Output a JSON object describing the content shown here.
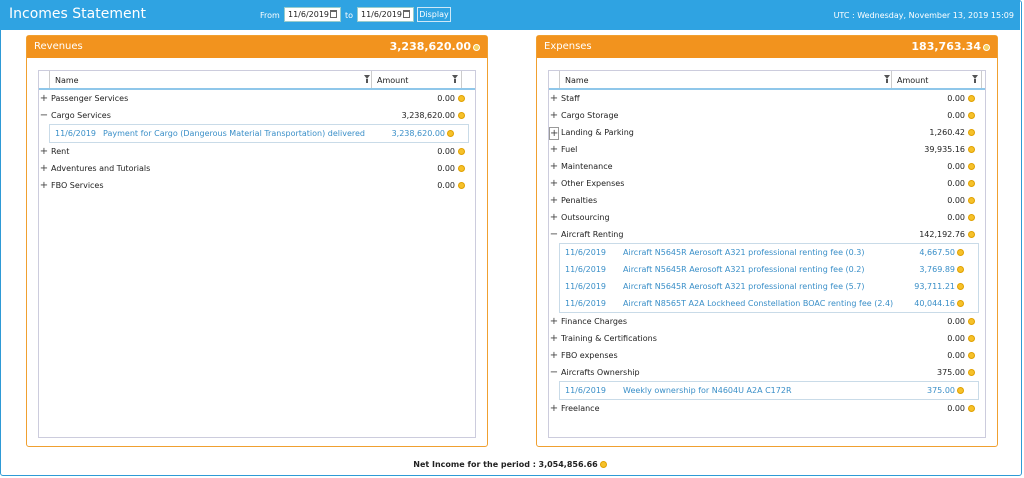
{
  "header": {
    "title": "Incomes Statement",
    "from_label": "From",
    "from_value": "11/6/2019",
    "to_label": "to",
    "to_value": "11/6/2019",
    "display_label": "Display",
    "clock": "UTC : Wednesday, November 13, 2019 15:09"
  },
  "revenues": {
    "title": "Revenues",
    "total": "3,238,620.00",
    "col_name": "Name",
    "col_amount": "Amount",
    "rows": [
      {
        "expander": "+",
        "name": "Passenger Services",
        "amount": "0.00"
      },
      {
        "expander": "−",
        "name": "Cargo Services",
        "amount": "3,238,620.00"
      },
      {
        "expander": "+",
        "name": "Rent",
        "amount": "0.00"
      },
      {
        "expander": "+",
        "name": "Adventures and Tutorials",
        "amount": "0.00"
      },
      {
        "expander": "+",
        "name": "FBO Services",
        "amount": "0.00"
      }
    ],
    "cargo_details": [
      {
        "date": "11/6/2019",
        "desc": "Payment for Cargo (Dangerous Material Transportation) delivered",
        "amount": "3,238,620.00"
      }
    ]
  },
  "expenses": {
    "title": "Expenses",
    "total": "183,763.34",
    "col_name": "Name",
    "col_amount": "Amount",
    "rows_a": [
      {
        "expander": "+",
        "name": "Staff",
        "amount": "0.00"
      },
      {
        "expander": "+",
        "name": "Cargo Storage",
        "amount": "0.00"
      },
      {
        "expander": "+",
        "name": "Landing & Parking",
        "amount": "1,260.42"
      },
      {
        "expander": "+",
        "name": "Fuel",
        "amount": "39,935.16"
      },
      {
        "expander": "+",
        "name": "Maintenance",
        "amount": "0.00"
      },
      {
        "expander": "+",
        "name": "Other Expenses",
        "amount": "0.00"
      },
      {
        "expander": "+",
        "name": "Penalties",
        "amount": "0.00"
      },
      {
        "expander": "+",
        "name": "Outsourcing",
        "amount": "0.00"
      },
      {
        "expander": "−",
        "name": "Aircraft Renting",
        "amount": "142,192.76"
      }
    ],
    "renting_details": [
      {
        "date": "11/6/2019",
        "desc": "Aircraft N5645R Aerosoft A321 professional renting fee (0.3)",
        "amount": "4,667.50"
      },
      {
        "date": "11/6/2019",
        "desc": "Aircraft N5645R Aerosoft A321 professional renting fee (0.2)",
        "amount": "3,769.89"
      },
      {
        "date": "11/6/2019",
        "desc": "Aircraft N5645R Aerosoft A321 professional renting fee (5.7)",
        "amount": "93,711.21"
      },
      {
        "date": "11/6/2019",
        "desc": "Aircraft N8565T A2A Lockheed Constellation BOAC renting fee (2.4)",
        "amount": "40,044.16"
      }
    ],
    "rows_b": [
      {
        "expander": "+",
        "name": "Finance Charges",
        "amount": "0.00"
      },
      {
        "expander": "+",
        "name": "Training & Certifications",
        "amount": "0.00"
      },
      {
        "expander": "+",
        "name": "FBO expenses",
        "amount": "0.00"
      },
      {
        "expander": "−",
        "name": "Aircrafts Ownership",
        "amount": "375.00"
      }
    ],
    "ownership_details": [
      {
        "date": "11/6/2019",
        "desc": "Weekly ownership for N4604U A2A C172R",
        "amount": "375.00"
      }
    ],
    "rows_c": [
      {
        "expander": "+",
        "name": "Freelance",
        "amount": "0.00"
      }
    ]
  },
  "footer": {
    "label": "Net Income for the period :",
    "value": "3,054,856.66"
  },
  "colors": {
    "topbar": "#2fa3e2",
    "panel_header": "#f2931e",
    "detail_text": "#3a8fc8",
    "coin": "#f6c12a"
  }
}
